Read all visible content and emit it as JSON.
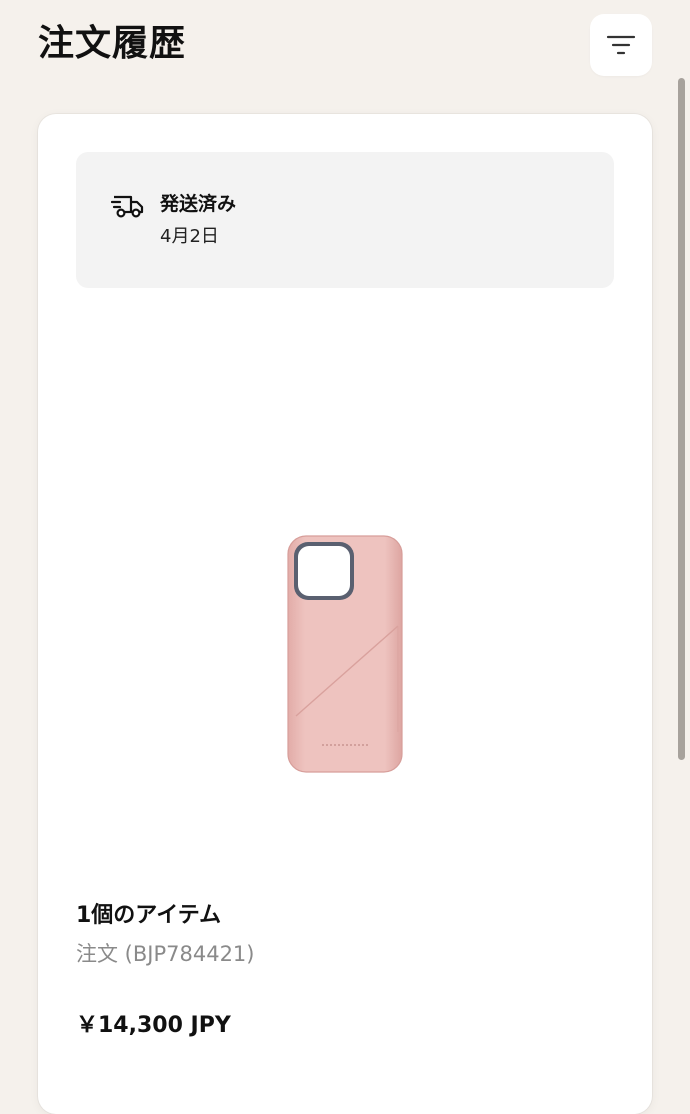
{
  "header": {
    "title": "注文履歴",
    "filter_icon": "filter-lines-icon"
  },
  "order": {
    "status": {
      "icon": "delivery-truck-icon",
      "label": "発送済み",
      "date": "4月2日"
    },
    "product": {
      "image": "pink-leather-phone-case-with-card-pocket",
      "color": "#e9b9b5"
    },
    "items_count": "1個のアイテム",
    "order_number": "注文 (BJP784421)",
    "price": "￥14,300 JPY"
  },
  "colors": {
    "background": "#f5f1ec",
    "card": "#ffffff",
    "status_box": "#f3f3f3",
    "muted_text": "#8a8a8a"
  }
}
